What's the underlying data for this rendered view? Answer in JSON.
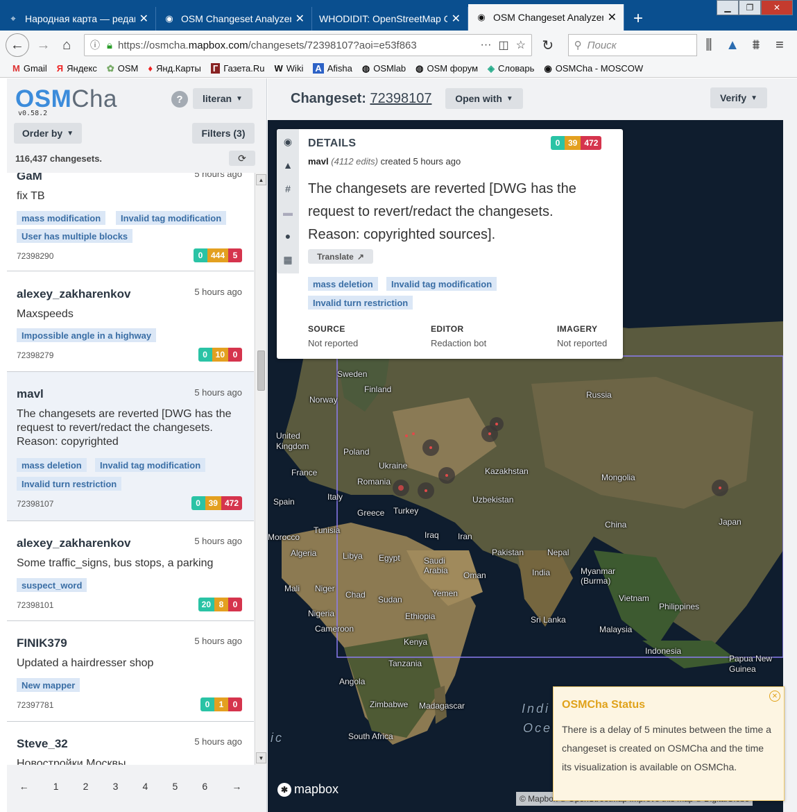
{
  "browser": {
    "tabs": [
      {
        "title": "Народная карта — редакт",
        "icon": "map-pin-icon"
      },
      {
        "title": "OSM Changeset Analyzer",
        "icon": "osmcha-icon"
      },
      {
        "title": "WHODIDIT: OpenStreetMap Ch",
        "icon": "none"
      },
      {
        "title": "OSM Changeset Analyzer",
        "icon": "osmcha-icon"
      }
    ],
    "active_tab": 3,
    "url_prefix": "https://osmcha.",
    "url_domain": "mapbox.com",
    "url_rest": "/changesets/72398107?aoi=e53f863",
    "search_placeholder": "Поиск",
    "bookmarks": [
      "Gmail",
      "Яндекс",
      "OSM",
      "Янд.Карты",
      "Газета.Ru",
      "Wiki",
      "Afisha",
      "OSMlab",
      "OSM форум",
      "Словарь",
      "OSMCha - MOSCOW"
    ]
  },
  "sidebar": {
    "brand_osm": "OSM",
    "brand_cha": "Cha",
    "version": "v0.58.2",
    "help": "?",
    "user": "literan",
    "order_by": "Order by",
    "filters": "Filters (3)",
    "count_text": "116,437 changesets."
  },
  "changesets": [
    {
      "user": "GaM",
      "time": "5 hours ago",
      "comment": "fix TB",
      "tags": [
        "mass modification",
        "Invalid tag modification",
        "User has multiple blocks"
      ],
      "id": "72398290",
      "counts": [
        "0",
        "444",
        "5"
      ]
    },
    {
      "user": "alexey_zakharenkov",
      "time": "5 hours ago",
      "comment": "Maxspeeds",
      "tags": [
        "Impossible angle in a highway"
      ],
      "id": "72398279",
      "counts": [
        "0",
        "10",
        "0"
      ]
    },
    {
      "user": "mavl",
      "time": "5 hours ago",
      "comment": "The changesets are reverted [DWG has the request to revert/redact the changesets. Reason: copyrighted",
      "tags": [
        "mass deletion",
        "Invalid tag modification",
        "Invalid turn restriction"
      ],
      "id": "72398107",
      "counts": [
        "0",
        "39",
        "472"
      ]
    },
    {
      "user": "alexey_zakharenkov",
      "time": "5 hours ago",
      "comment": "Some traffic_signs, bus stops, a parking",
      "tags": [
        "suspect_word"
      ],
      "id": "72398101",
      "counts": [
        "20",
        "8",
        "0"
      ]
    },
    {
      "user": "FINIK379",
      "time": "5 hours ago",
      "comment": "Updated a hairdresser shop",
      "tags": [
        "New mapper"
      ],
      "id": "72397781",
      "counts": [
        "0",
        "1",
        "0"
      ]
    },
    {
      "user": "Steve_32",
      "time": "5 hours ago",
      "comment": "Новостройки Москвы",
      "tags": [],
      "id": "",
      "counts": []
    }
  ],
  "pager": [
    "←",
    "1",
    "2",
    "3",
    "4",
    "5",
    "6",
    "→"
  ],
  "header": {
    "changeset_label": "Changeset:",
    "changeset_id": "72398107",
    "open_with": "Open with",
    "verify": "Verify"
  },
  "details": {
    "title": "DETAILS",
    "counts": [
      "0",
      "39",
      "472"
    ],
    "user": "mavl",
    "edits": "(4112 edits)",
    "created": "created 5 hours ago",
    "comment": "The changesets are reverted [DWG has the request to revert/redact the changesets. Reason: copyrighted sources].",
    "translate": "Translate",
    "tags": [
      "mass deletion",
      "Invalid tag modification",
      "Invalid turn restriction"
    ],
    "source_label": "SOURCE",
    "source": "Not reported",
    "editor_label": "EDITOR",
    "editor": "Redaction bot",
    "imagery_label": "IMAGERY",
    "imagery": "Not reported"
  },
  "map": {
    "labels": [
      "Sweden",
      "Finland",
      "Norway",
      "Russia",
      "United Kingdom",
      "Poland",
      "Ukraine",
      "France",
      "Romania",
      "Kazakhstan",
      "Mongolia",
      "Spain",
      "Italy",
      "Uzbekistan",
      "Greece",
      "Turkey",
      "Tunisia",
      "Iraq",
      "Iran",
      "China",
      "Japan",
      "Morocco",
      "Algeria",
      "Libya",
      "Egypt",
      "Saudi Arabia",
      "Pakistan",
      "Nepal",
      "Oman",
      "India",
      "Myanmar (Burma)",
      "Mali",
      "Niger",
      "Chad",
      "Sudan",
      "Yemen",
      "Vietnam",
      "Philippines",
      "Nigeria",
      "Ethiopia",
      "Sri Lanka",
      "Cameroon",
      "Malaysia",
      "Kenya",
      "Indonesia",
      "Tanzania",
      "Papua New Guinea",
      "Angola",
      "Zimbabwe",
      "Madagascar",
      "South Africa"
    ],
    "ocean_labels": [
      "Indi",
      "Oce",
      "ic"
    ],
    "mapbox_logo": "mapbox",
    "attribution": "© Mapbox © OpenStreetMap  Improve this map  © DigitalGlobe"
  },
  "status": {
    "title": "OSMCha Status",
    "body": "There is a delay of 5 minutes between the time a changeset is created on OSMCha and the time its visualization is available on OSMCha."
  }
}
